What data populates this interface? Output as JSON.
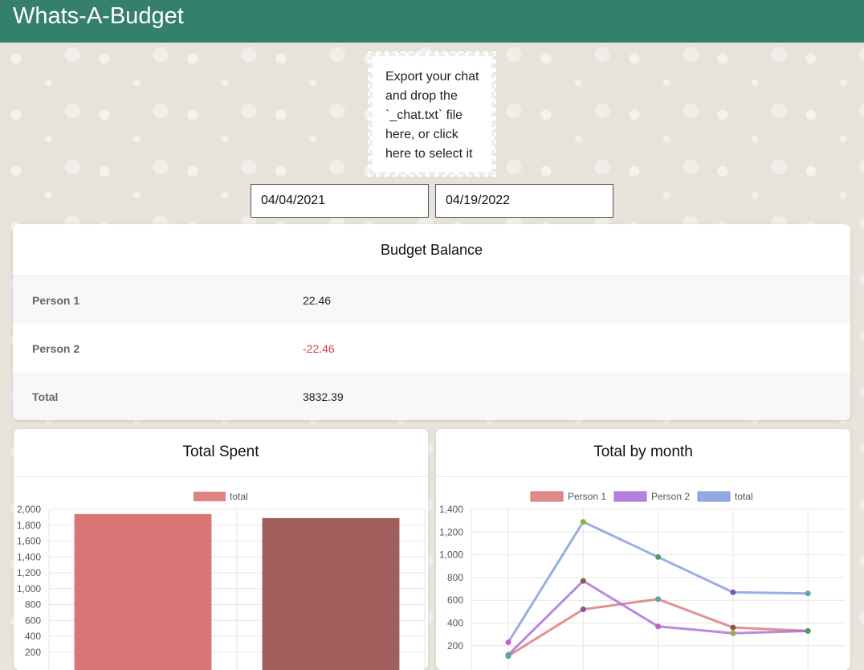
{
  "header": {
    "title": "Whats-A-Budget"
  },
  "dropzone": {
    "text": "Export your chat and drop the `_chat.txt` file here, or click here to select it"
  },
  "date_range": {
    "start": "04/04/2021",
    "end": "04/19/2022"
  },
  "balance": {
    "title": "Budget Balance",
    "rows": [
      {
        "label": "Person 1",
        "value": "22.46"
      },
      {
        "label": "Person 2",
        "value": "-22.46"
      },
      {
        "label": "Total",
        "value": "3832.39"
      }
    ],
    "negative_color": "#d9443f"
  },
  "colors": {
    "header": "#35806a"
  },
  "chart_data": [
    {
      "type": "bar",
      "title": "Total Spent",
      "categories": [
        "",
        ""
      ],
      "series": [
        {
          "name": "total",
          "values": [
            1940,
            1890
          ],
          "colors": [
            "#d97574",
            "#a05e5d"
          ]
        }
      ],
      "ylim": [
        200,
        2000
      ],
      "yticks": [
        "2,000",
        "1,800",
        "1,600",
        "1,400",
        "1,200",
        "1,000",
        "800",
        "600",
        "400",
        "200"
      ],
      "legend": "top-center",
      "grid": true
    },
    {
      "type": "line",
      "title": "Total by month",
      "x": [
        1,
        2,
        3,
        4,
        5
      ],
      "series": [
        {
          "name": "Person 1",
          "values": [
            110,
            520,
            610,
            360,
            330
          ],
          "color": "#d97574"
        },
        {
          "name": "Person 2",
          "values": [
            120,
            770,
            370,
            310,
            330
          ],
          "color": "#a86bd9"
        },
        {
          "name": "total",
          "values": [
            230,
            1290,
            980,
            670,
            660
          ],
          "color": "#7f9bd9"
        }
      ],
      "ylim": [
        200,
        1400
      ],
      "yticks": [
        "1,400",
        "1,200",
        "1,000",
        "800",
        "600",
        "400",
        "200"
      ],
      "legend": "top-center",
      "grid": true
    }
  ]
}
